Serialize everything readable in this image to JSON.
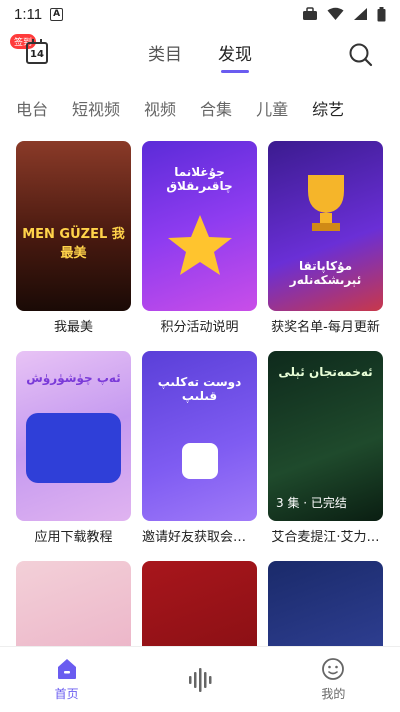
{
  "status_bar": {
    "time": "1:11",
    "notification_letter": "A"
  },
  "header": {
    "signin_badge": "签到",
    "calendar_day": "14",
    "tabs": [
      {
        "label": "类目",
        "active": false
      },
      {
        "label": "发现",
        "active": true
      }
    ]
  },
  "categories": [
    {
      "label": "电台",
      "active": false
    },
    {
      "label": "短视频",
      "active": false
    },
    {
      "label": "视频",
      "active": false
    },
    {
      "label": "合集",
      "active": false
    },
    {
      "label": "儿童",
      "active": false
    },
    {
      "label": "综艺",
      "active": true
    }
  ],
  "cards": [
    {
      "title": "我最美",
      "cover_text": "MEN GÜZEL 我最美",
      "badge": ""
    },
    {
      "title": "积分活动说明",
      "cover_text": "جۇغلانما چاقىرىقلاق",
      "badge": ""
    },
    {
      "title": "获奖名单-每月更新",
      "cover_text": "مۇكاپاتقا ئېرىشكەنلەر",
      "badge": ""
    },
    {
      "title": "应用下载教程",
      "cover_text": "ئەپ چۈشۈرۈش",
      "badge": ""
    },
    {
      "title": "邀请好友获取会员…",
      "cover_text": "دوست تەكلىپ قىلىپ",
      "badge": ""
    },
    {
      "title": "艾合麦提江·艾力…",
      "cover_text": "ئەخمەتجان ئېلى",
      "badge": "3 集 · 已完结"
    },
    {
      "title": "",
      "cover_text": "",
      "badge": ""
    },
    {
      "title": "",
      "cover_text": "",
      "badge": ""
    },
    {
      "title": "",
      "cover_text": "",
      "badge": ""
    }
  ],
  "bottom_nav": [
    {
      "label": "首页",
      "icon": "home-icon",
      "active": true
    },
    {
      "label": "",
      "icon": "audio-wave-icon",
      "active": false
    },
    {
      "label": "我的",
      "icon": "profile-icon",
      "active": false
    }
  ],
  "colors": {
    "accent": "#6a5cf0",
    "badge_red": "#ff3b3b"
  }
}
